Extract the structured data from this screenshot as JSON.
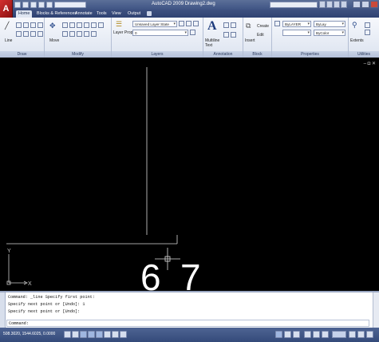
{
  "window": {
    "title": "AutoCAD 2009  Drawing2.dwg"
  },
  "ribbon": {
    "tabs": [
      "Home",
      "Blocks & References",
      "Annotate",
      "Tools",
      "View",
      "Output"
    ],
    "active_tab": "Home",
    "panels": {
      "draw": {
        "title": "Draw",
        "line_label": "Line"
      },
      "modify": {
        "title": "Modify",
        "move_label": "Move"
      },
      "layers": {
        "title": "Layers",
        "layer_state": "Unsaved Layer State",
        "layer_props_label": "Layer Properties",
        "current_layer": "0"
      },
      "annotation": {
        "title": "Annotation",
        "multiline_text_label": "Multiline Text"
      },
      "block": {
        "title": "Block",
        "insert_label": "Insert",
        "create_label": "Create",
        "edit_label": "Edit"
      },
      "properties": {
        "title": "Properties",
        "color_value": "ByLAYER",
        "linetype_value": "ByLay",
        "lineweight_value": "ByColor"
      },
      "utilities": {
        "title": "Utilities",
        "extents_label": "Extents"
      }
    }
  },
  "drawing": {
    "background_color": "#000000",
    "line_color": "#d8d8d8",
    "ucs_y_label": "Y",
    "ucs_x_label": "X",
    "overlay_text": [
      "6",
      "7"
    ]
  },
  "command_window": {
    "history": [
      "Command: _line Specify first point:",
      "Specify next point or [Undo]: 1",
      "Specify next point or [Undo]:"
    ],
    "prompt": "Command:"
  },
  "status_bar": {
    "coordinates": "508.3020, 1544.6025, 0.0000"
  },
  "colors": {
    "title_bar": "#4a5e8e",
    "ribbon": "#e6ebf5",
    "app_button": "#c42020"
  }
}
